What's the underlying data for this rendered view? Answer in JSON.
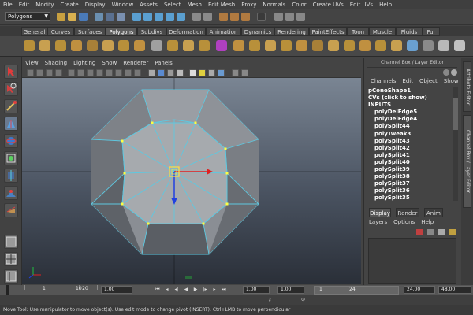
{
  "menubar": {
    "items": [
      "File",
      "Edit",
      "Modify",
      "Create",
      "Display",
      "Window",
      "Assets",
      "Select",
      "Mesh",
      "Edit Mesh",
      "Proxy",
      "Normals",
      "Color",
      "Create UVs",
      "Edit UVs",
      "Help"
    ]
  },
  "statusline": {
    "mode_value": "Polygons"
  },
  "shelf": {
    "tabs": [
      "General",
      "Curves",
      "Surfaces",
      "Polygons",
      "Subdivs",
      "Deformation",
      "Animation",
      "Dynamics",
      "Rendering",
      "PaintEffects",
      "Toon",
      "Muscle",
      "Fluids",
      "Fur"
    ],
    "active_tab": "Polygons"
  },
  "panel": {
    "menu": [
      "View",
      "Shading",
      "Lighting",
      "Show",
      "Renderer",
      "Panels"
    ]
  },
  "channel_box": {
    "title": "Channel Box / Layer Editor",
    "menu": [
      "Channels",
      "Edit",
      "Object",
      "Show"
    ],
    "object_name": "pConeShape1",
    "cvs_label": "CVs (click to show)",
    "inputs_label": "INPUTS",
    "inputs": [
      "polyDelEdge5",
      "polyDelEdge4",
      "polySplit44",
      "polyTweak3",
      "polySplit43",
      "polySplit42",
      "polySplit41",
      "polySplit40",
      "polySplit39",
      "polySplit38",
      "polySplit37",
      "polySplit36",
      "polySplit35"
    ]
  },
  "layer_editor": {
    "tabs": [
      "Display",
      "Render",
      "Anim"
    ],
    "active_tab": "Display",
    "menu": [
      "Layers",
      "Options",
      "Help"
    ]
  },
  "side_tabs": [
    "Attribute Editor",
    "Channel Box / Layer Editor"
  ],
  "time_slider": {
    "tick_labels": [
      "1",
      "10",
      "20"
    ]
  },
  "range": {
    "field1": "1.00",
    "field2": "1.00",
    "field3": "1.00",
    "field4": "1.00",
    "start": "1",
    "end": "24",
    "field5": "24.00",
    "field6": "48.00"
  },
  "help_line": "Move Tool: Use manipulator to move object(s). Use edit mode to change pivot (INSERT).  Ctrl+LMB to move perpendicular",
  "colors": {
    "mesh_wire": "#5ec8e0",
    "vertex": "#ffff40",
    "manip_x": "#e02020",
    "manip_y": "#2040e0",
    "manip_center": "#ffe040"
  }
}
